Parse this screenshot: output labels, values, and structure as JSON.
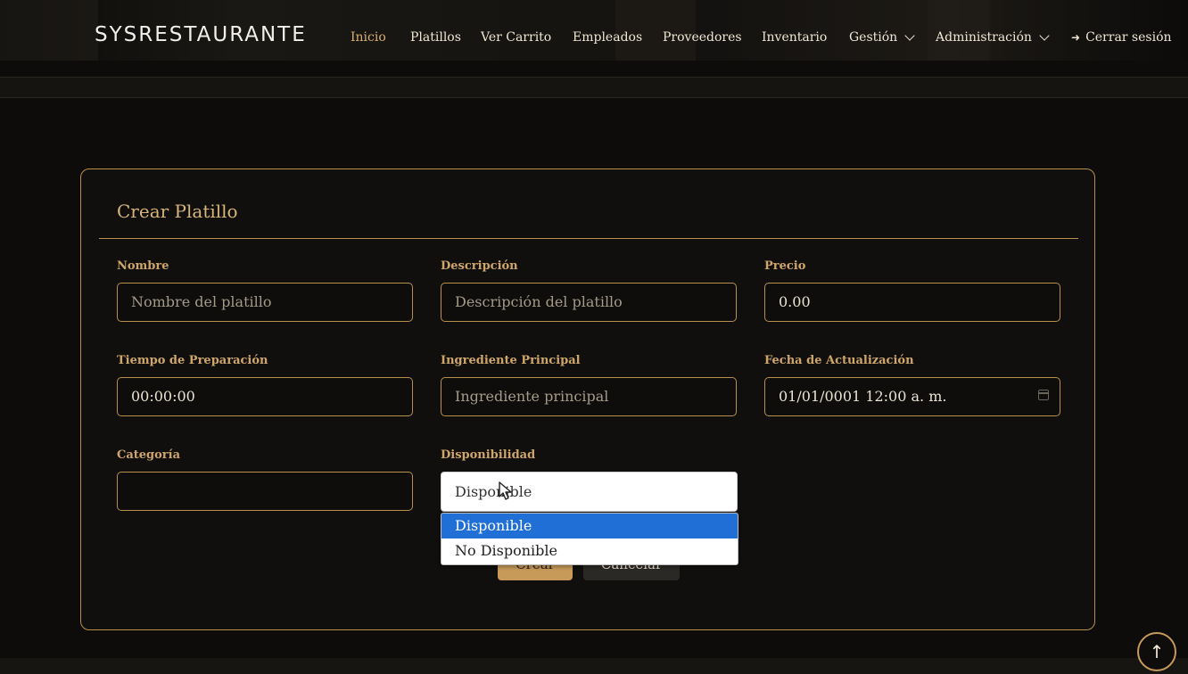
{
  "brand": "SYSRESTAURANTE",
  "nav": {
    "inicio": "Inicio",
    "platillos": "Platillos",
    "ver_carrito": "Ver Carrito",
    "empleados": "Empleados",
    "proveedores": "Proveedores",
    "inventario": "Inventario",
    "gestion": "Gestión",
    "administracion": "Administración",
    "cerrar_sesion": "Cerrar sesión"
  },
  "form": {
    "title": "Crear Platillo",
    "nombre": {
      "label": "Nombre",
      "placeholder": "Nombre del platillo"
    },
    "descripcion": {
      "label": "Descripción",
      "placeholder": "Descripción del platillo"
    },
    "precio": {
      "label": "Precio",
      "value": "0.00"
    },
    "tiempo": {
      "label": "Tiempo de Preparación",
      "value": "00:00:00"
    },
    "ingrediente": {
      "label": "Ingrediente Principal",
      "placeholder": "Ingrediente principal"
    },
    "fecha": {
      "label": "Fecha de Actualización",
      "value": "01/01/0001 12:00  a. m."
    },
    "categoria": {
      "label": "Categoría",
      "value": ""
    },
    "disponibilidad": {
      "label": "Disponibilidad",
      "value": "Disponible",
      "options": [
        "Disponible",
        "No Disponible"
      ]
    },
    "create_label": "Crear",
    "cancel_label": "Cancelar"
  },
  "colors": {
    "accent": "#c79a5a",
    "label": "#cfa66a",
    "selected_option": "#1f6fd6"
  },
  "icons": {
    "scroll_top": "arrow-up-icon",
    "logout": "sign-out-icon",
    "calendar": "calendar-icon"
  }
}
